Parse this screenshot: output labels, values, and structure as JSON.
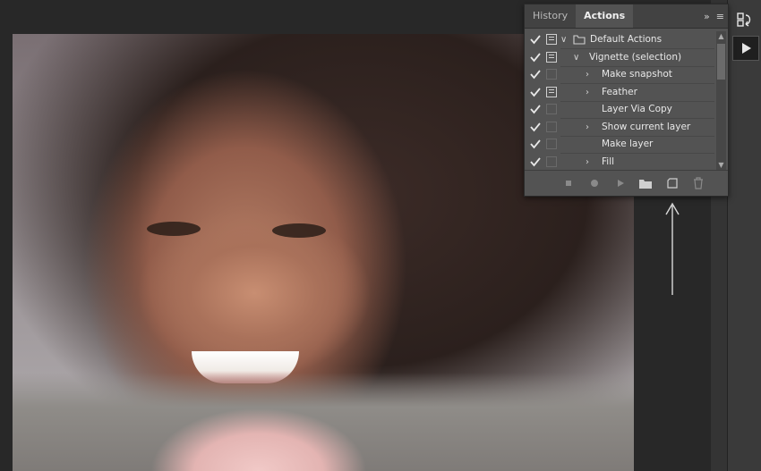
{
  "panel": {
    "tabs": [
      {
        "label": "History"
      },
      {
        "label": "Actions"
      }
    ],
    "menu_glyphs": {
      "collapse": "»",
      "menu": "≡"
    }
  },
  "actions": [
    {
      "label": "Default Actions",
      "level": 0,
      "expanded": true,
      "checked": true,
      "dialog": true,
      "kind": "set"
    },
    {
      "label": "Vignette (selection)",
      "level": 1,
      "expanded": true,
      "checked": true,
      "dialog": true,
      "kind": "action"
    },
    {
      "label": "Make snapshot",
      "level": 2,
      "expandable": true,
      "checked": true,
      "dialog": false
    },
    {
      "label": "Feather",
      "level": 2,
      "expandable": true,
      "checked": true,
      "dialog": true
    },
    {
      "label": "Layer Via Copy",
      "level": 2,
      "expandable": false,
      "checked": true,
      "dialog": false
    },
    {
      "label": "Show current layer",
      "level": 2,
      "expandable": true,
      "checked": true,
      "dialog": false
    },
    {
      "label": "Make layer",
      "level": 2,
      "expandable": false,
      "checked": true,
      "dialog": false
    },
    {
      "label": "Fill",
      "level": 2,
      "expandable": true,
      "checked": true,
      "dialog": false
    }
  ],
  "footer_icons": [
    "stop-icon",
    "record-icon",
    "play-icon",
    "folder-icon",
    "new-action-icon",
    "trash-icon"
  ],
  "colors": {
    "panel_bg": "#535353",
    "tab_bar": "#424242",
    "canvas_bg": "#282828"
  }
}
